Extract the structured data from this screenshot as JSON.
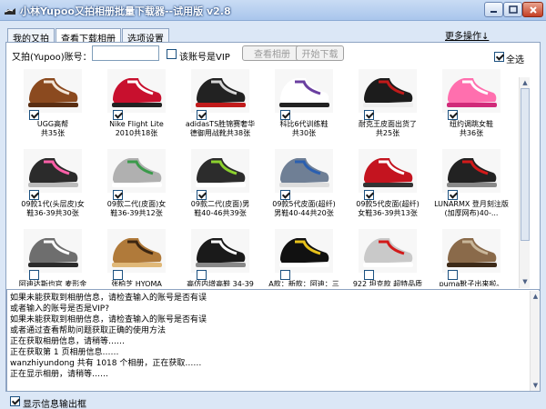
{
  "window": {
    "title": "小林Yupoo又拍相册批量下载器--试用版 v2.8",
    "colors": {
      "titlebar": "#a9c6ec",
      "panel": "#ffffff",
      "background": "#dbe7f6",
      "close": "#c43f24"
    }
  },
  "tabs": [
    {
      "label": "我的又拍",
      "active": false
    },
    {
      "label": "查看下载相册",
      "active": true
    },
    {
      "label": "选项设置",
      "active": false
    }
  ],
  "more_link": "更多操作↓",
  "account": {
    "label": "又拍(Yupoo)账号：",
    "value": "",
    "vip_label": "该账号是VIP",
    "vip_checked": false,
    "view_button": "查看相册",
    "start_button": "开始下载",
    "select_all_label": "全选",
    "select_all_checked": true
  },
  "albums": [
    {
      "caption": "UGG高帮\n共35张",
      "icon": "brown-boot-icon",
      "checked": true
    },
    {
      "caption": "Nike Flight Lite\n2010共18张",
      "icon": "red-high-top-icon",
      "checked": true
    },
    {
      "caption": "adidasTS胜锦赛奢华\n德御用战靴共38张",
      "icon": "black-high-top-icon",
      "checked": true
    },
    {
      "caption": "科比6代训练鞋\n共30张",
      "icon": "purple-sneaker-icon",
      "checked": true
    },
    {
      "caption": "耐克王皮面出货了\n共25张",
      "icon": "black-red-sneaker-icon",
      "checked": true
    },
    {
      "caption": "纽约调跳女鞋\n共36张",
      "icon": "pink-sneaker-icon",
      "checked": true
    },
    {
      "caption": "09款1代(头层皮)女\n鞋36-39共30张",
      "icon": "pink-black-runner-icon",
      "checked": true
    },
    {
      "caption": "09款二代(皮面)女\n鞋36-39共12张",
      "icon": "grey-runner-icon",
      "checked": true
    },
    {
      "caption": "09款二代(皮面)男\n鞋40-46共39张",
      "icon": "green-runner-icon",
      "checked": true
    },
    {
      "caption": "09款5代皮面(超纤)\n男鞋40-44共20张",
      "icon": "blue-runner-icon",
      "checked": true
    },
    {
      "caption": "09款5代皮面(超纤)\n女鞋36-39共13张",
      "icon": "red-runner-icon",
      "checked": true
    },
    {
      "caption": "LUNARMX 登月刻注版\n(加厚网布)40-...",
      "icon": "black-runner-icon",
      "checked": true
    },
    {
      "caption": "阿迪达斯也官 麦形金",
      "icon": "grey-skate-icon",
      "checked": false
    },
    {
      "caption": "张柏芝 HYOMA",
      "icon": "leopard-boot-icon",
      "checked": false
    },
    {
      "caption": "高仿内增高鞋 34-39",
      "icon": "black-white-sneaker-icon",
      "checked": false
    },
    {
      "caption": "A款：新款：阿迪：三",
      "icon": "black-yellow-sneaker-icon",
      "checked": false
    },
    {
      "caption": "922 坦克款 超特品质",
      "icon": "silver-red-sneaker-icon",
      "checked": false
    },
    {
      "caption": "puma靴子出来啦。",
      "icon": "boots-shelf-icon",
      "checked": false
    }
  ],
  "log_lines": [
    "如果未能获取到相册信息，请检查输入的账号是否有误",
    "或者输入的账号是否是VIP?",
    "如果未能获取到相册信息，请检查输入的账号是否有误",
    "或者通过查看帮助问题获取正确的使用方法",
    "正在获取相册信息，请稍等……",
    "正在获取第 1 页相册信息……",
    "wanzhiyundong 共有 1018 个相册，正在获取……",
    "正在显示相册，请稍等……"
  ],
  "footer": {
    "label": "显示信息输出框",
    "checked": true
  }
}
